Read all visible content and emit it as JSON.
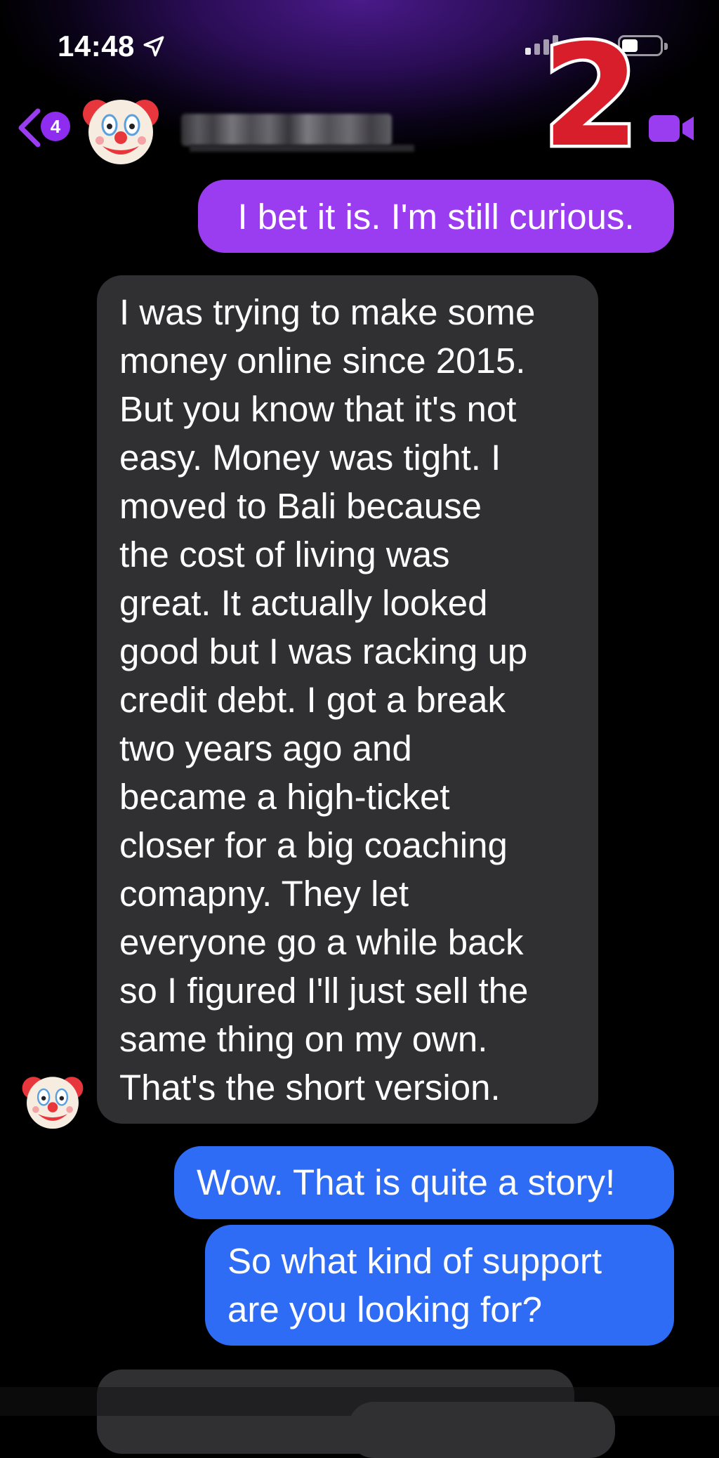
{
  "status_bar": {
    "time": "14:48",
    "location_icon": "location-arrow-icon",
    "signal_icon": "cellular-signal-icon",
    "battery_icon": "battery-icon"
  },
  "header": {
    "back_icon": "chevron-left-icon",
    "unread_count": "4",
    "contact_avatar": "clown-face-emoji",
    "contact_name_redacted": true,
    "video_call_icon": "video-camera-icon"
  },
  "overlay_number": "2",
  "messages": [
    {
      "side": "outgoing",
      "lines": [
        "I bet it is. I'm still curious."
      ]
    },
    {
      "side": "incoming",
      "lines": [
        "I was trying to make some",
        "money online since 2015.",
        "But you know that it's not",
        "easy. Money was tight. I",
        "moved to Bali because",
        "the cost of living was",
        "great. It actually looked",
        "good but I was racking up",
        "credit debt. I got a break",
        "two years ago and",
        "became a high-ticket",
        "closer for a big coaching",
        "comapny. They let",
        "everyone go a while back",
        "so I figured I'll just sell the",
        "same thing on my own.",
        "That's the short version."
      ]
    },
    {
      "side": "outgoing",
      "lines": [
        "Wow. That is quite a story!"
      ]
    },
    {
      "side": "outgoing",
      "lines": [
        "So what kind of support",
        "are you looking for?"
      ]
    }
  ],
  "colors": {
    "accent_purple": "#9a3df0",
    "incoming_bubble": "#303033",
    "outgoing_blue": "#2e6cf6",
    "overlay_red": "#d81e2a"
  }
}
